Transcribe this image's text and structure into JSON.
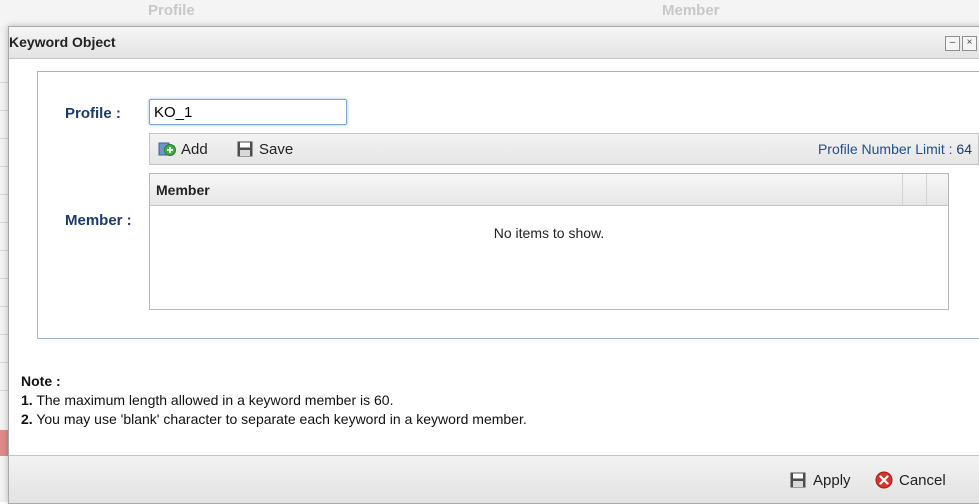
{
  "background": {
    "col_profile": "Profile",
    "col_member": "Member"
  },
  "dialog": {
    "title": "Keyword Object",
    "minimize_symbol": "–",
    "close_symbol": "×"
  },
  "form": {
    "profile_label": "Profile :",
    "profile_value": "KO_1",
    "member_label": "Member :"
  },
  "toolbar": {
    "add_label": "Add",
    "add_icon": "add-icon",
    "save_label": "Save",
    "save_icon": "save-icon",
    "limit_label": "Profile Number Limit :",
    "limit_value": "64"
  },
  "grid": {
    "columns": [
      "Member"
    ],
    "empty_text": "No items to show."
  },
  "note": {
    "title": "Note :",
    "items": [
      {
        "num": "1.",
        "text": "The maximum length allowed in a keyword member is 60."
      },
      {
        "num": "2.",
        "text": "You may use 'blank' character to separate each keyword in a keyword member."
      }
    ]
  },
  "footer": {
    "apply_label": "Apply",
    "apply_icon": "save-icon",
    "cancel_label": "Cancel",
    "cancel_icon": "cancel-icon"
  },
  "colors": {
    "label_blue": "#1c3b6b",
    "input_focus": "#7ea6d6",
    "add_green": "#3fae3f",
    "cancel_red": "#d9342b"
  }
}
